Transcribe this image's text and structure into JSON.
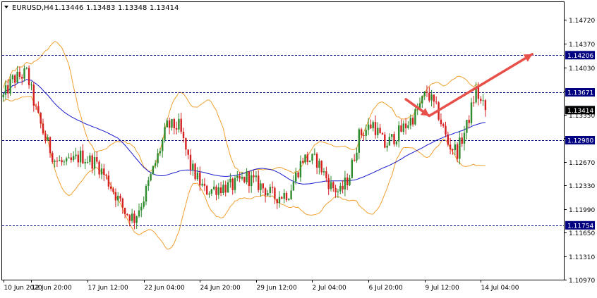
{
  "header": {
    "dropdown_icon": "triangle-down-icon",
    "symbol_timeframe": "EURUSD,H4",
    "open": "1.13446",
    "high": "1.13483",
    "low": "1.13348",
    "close": "1.13414"
  },
  "colors": {
    "background": "#ffffff",
    "bull_candle": "#2e8b2e",
    "bear_candle": "#d42020",
    "bollinger": "#f0a030",
    "moving_average": "#1a1acc",
    "level_line": "#000080",
    "level_label_bg": "#000080",
    "level_label_text": "#ffffff",
    "current_price_bg": "#000000",
    "arrow": "#e8504a",
    "grid": "#cccccc",
    "axis": "#000000"
  },
  "chart_data": {
    "type": "candlestick",
    "symbol": "EURUSD",
    "timeframe": "H4",
    "ylim": [
      1.1097,
      1.1497
    ],
    "price_ticks": [
      "1.14720",
      "1.14370",
      "1.14030",
      "1.13690",
      "1.13350",
      "1.13010",
      "1.12670",
      "1.12330",
      "1.11990",
      "1.11650",
      "1.11310",
      "1.10970"
    ],
    "price_tick_values": [
      1.1472,
      1.1437,
      1.1403,
      1.1369,
      1.1335,
      1.1301,
      1.1267,
      1.1233,
      1.1199,
      1.1165,
      1.1131,
      1.1097
    ],
    "time_ticks": [
      "10 Jun 2020",
      "12 Jun 20:00",
      "17 Jun 12:00",
      "22 Jun 04:00",
      "24 Jun 20:00",
      "29 Jun 12:00",
      "2 Jul 04:00",
      "6 Jul 20:00",
      "9 Jul 12:00",
      "14 Jul 04:00"
    ],
    "horizontal_levels": [
      {
        "label": "1.14206",
        "value": 1.14206
      },
      {
        "label": "1.13671",
        "value": 1.13671
      },
      {
        "label": "1.12980",
        "value": 1.1298
      },
      {
        "label": "1.11754",
        "value": 1.11754
      }
    ],
    "current_price": {
      "label": "1.13414",
      "value": 1.13414
    },
    "grid": false,
    "indicators": [
      "bollinger-bands",
      "moving-average"
    ],
    "drawn_arrow": {
      "from": {
        "bar": 172,
        "price": 1.1357
      },
      "via": {
        "bar": 182,
        "price": 1.1333
      },
      "to": {
        "bar": 226,
        "price": 1.1422
      }
    }
  }
}
